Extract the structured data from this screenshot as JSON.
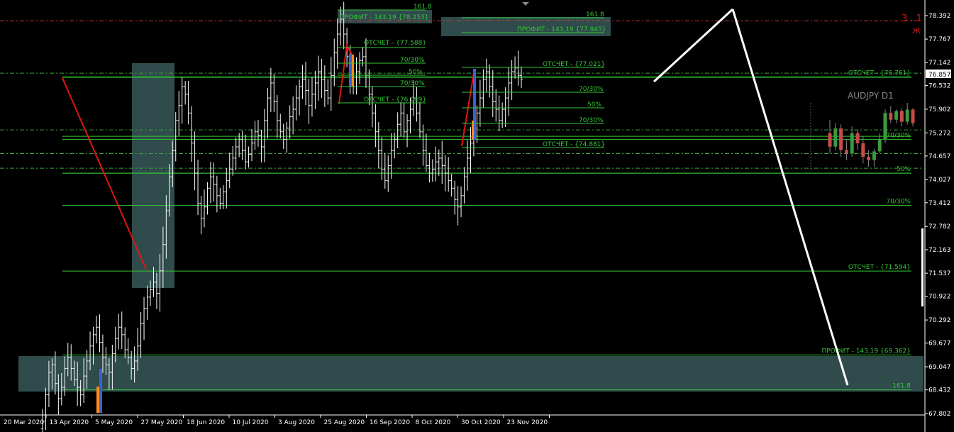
{
  "chart_data": {
    "type": "ohlc",
    "symbol_label": "AUDJPY D1",
    "price_axis": {
      "ticks": [
        "78.392",
        "77.767",
        "77.142",
        "76.532",
        "75.902",
        "75.272",
        "74.657",
        "74.027",
        "73.412",
        "72.782",
        "72.163",
        "71.537",
        "70.922",
        "70.292",
        "69.677",
        "69.047",
        "68.432",
        "67.802"
      ],
      "current_price": "76.857",
      "min": 67.802,
      "max": 78.392
    },
    "time_axis": {
      "ticks": [
        "20 Mar 2020",
        "13 Apr 2020",
        "5 May 2020",
        "27 May 2020",
        "18 Jun 2020",
        "10 Jul 2020",
        "3 Aug 2020",
        "25 Aug 2020",
        "16 Sep 2020",
        "8 Oct 2020",
        "30 Oct 2020",
        "23 Nov 2020"
      ]
    },
    "corner_label": "3 . 1",
    "corner_label_sub": "Ж",
    "levels": [
      {
        "price": 69.362,
        "label": "ПРОФИТ - 143,19 {69.362}"
      },
      {
        "price": 68.432,
        "label": "161.8"
      },
      {
        "price": 71.594,
        "label": "ОТСЧЕТ - {71.594}"
      },
      {
        "price": 73.34,
        "label": "70/30%"
      },
      {
        "price": 74.2,
        "label": "50%"
      },
      {
        "price": 75.1,
        "label": "70/30%"
      },
      {
        "price": 76.761,
        "label": "ОТСЧЕТ - {76.761}"
      }
    ],
    "dashed_levels": [
      {
        "price": 78.25,
        "color": "#d83a3a"
      },
      {
        "price": 76.86,
        "color": "#3aa53a"
      },
      {
        "price": 75.35,
        "color": "#3aa53a"
      },
      {
        "price": 74.72,
        "color": "#3aa53a"
      },
      {
        "price": 74.33,
        "color": "#3aa53a"
      }
    ],
    "fib_set_1": {
      "profit_label": "ПРОФИТ - 143,19 {78.253}",
      "fib_label": "161.8",
      "otschet_top": "ОТСЧЕТ - {77.588}",
      "r1": "70/30%",
      "r2": "50%",
      "r3": "70/30%",
      "otschet_bottom": "ОТСЧЕТ - {76.049}"
    },
    "fib_set_2": {
      "fib_label": "161.8",
      "profit_label": "ПРОФИТ - 143,19 {77.945}",
      "otschet_top": "ОТСЧЕТ - {77.021}",
      "r1": "70/30%",
      "r2": "50%",
      "r3": "70/30%",
      "otschet_bottom": "ОТСЧЕТ - {74.881}"
    },
    "mini_chart": {
      "label": "AUDJPY D1",
      "candles": [
        {
          "o": 0.55,
          "c": 0.35,
          "h": 0.75,
          "l": 0.25
        },
        {
          "o": 0.35,
          "c": 0.62,
          "h": 0.7,
          "l": 0.3
        },
        {
          "o": 0.62,
          "c": 0.3,
          "h": 0.68,
          "l": 0.2
        },
        {
          "o": 0.3,
          "c": 0.25,
          "h": 0.45,
          "l": 0.15
        },
        {
          "o": 0.25,
          "c": 0.55,
          "h": 0.65,
          "l": 0.2
        },
        {
          "o": 0.55,
          "c": 0.4,
          "h": 0.6,
          "l": 0.3
        },
        {
          "o": 0.4,
          "c": 0.2,
          "h": 0.5,
          "l": 0.1
        },
        {
          "o": 0.2,
          "c": 0.15,
          "h": 0.3,
          "l": 0.05
        },
        {
          "o": 0.15,
          "c": 0.28,
          "h": 0.32,
          "l": 0.05
        },
        {
          "o": 0.28,
          "c": 0.45,
          "h": 0.55,
          "l": 0.25
        },
        {
          "o": 0.45,
          "c": 0.85,
          "h": 0.9,
          "l": 0.4
        },
        {
          "o": 0.85,
          "c": 0.75,
          "h": 0.95,
          "l": 0.7
        },
        {
          "o": 0.75,
          "c": 0.88,
          "h": 0.9,
          "l": 0.7
        },
        {
          "o": 0.88,
          "c": 0.72,
          "h": 0.92,
          "l": 0.65
        },
        {
          "o": 0.72,
          "c": 0.9,
          "h": 1.0,
          "l": 0.68
        },
        {
          "o": 0.9,
          "c": 0.7,
          "h": 0.92,
          "l": 0.65
        }
      ]
    },
    "closes": [
      67.6,
      68.3,
      68.9,
      69.1,
      68.6,
      68.2,
      68.5,
      69.0,
      69.3,
      69.0,
      68.7,
      68.5,
      68.3,
      68.8,
      69.2,
      69.6,
      69.9,
      70.1,
      69.7,
      69.3,
      69.1,
      68.9,
      69.4,
      69.8,
      70.1,
      69.9,
      69.5,
      69.3,
      69.0,
      69.2,
      69.6,
      70.2,
      70.6,
      70.9,
      71.1,
      71.3,
      71.0,
      71.6,
      72.3,
      73.2,
      74.1,
      74.8,
      75.6,
      76.0,
      76.5,
      76.3,
      75.8,
      75.0,
      74.2,
      73.4,
      73.0,
      73.3,
      73.8,
      74.1,
      73.9,
      73.6,
      73.4,
      73.7,
      74.0,
      74.3,
      74.6,
      74.9,
      75.1,
      74.8,
      74.5,
      74.7,
      75.0,
      75.3,
      75.2,
      74.9,
      75.6,
      76.2,
      76.6,
      76.1,
      75.6,
      75.3,
      75.1,
      75.4,
      75.7,
      75.9,
      76.2,
      76.5,
      76.7,
      76.4,
      76.0,
      76.3,
      76.6,
      76.9,
      76.7,
      76.4,
      76.2,
      76.8,
      77.4,
      77.9,
      78.3,
      77.9,
      77.3,
      76.8,
      76.5,
      76.9,
      77.2,
      77.3,
      76.8,
      76.3,
      75.8,
      75.3,
      74.8,
      74.3,
      74.0,
      74.4,
      74.8,
      75.1,
      75.5,
      75.8,
      75.3,
      75.6,
      75.9,
      76.2,
      75.8,
      75.3,
      74.8,
      74.4,
      74.2,
      74.3,
      74.5,
      74.6,
      74.4,
      74.2,
      74.0,
      73.8,
      73.5,
      73.3,
      73.6,
      74.1,
      74.6,
      75.0,
      75.4,
      75.8,
      76.2,
      76.7,
      76.9,
      76.5,
      76.1,
      75.9,
      75.6,
      75.9,
      76.2,
      76.6,
      76.9,
      77.0,
      76.8,
      76.7
    ]
  }
}
